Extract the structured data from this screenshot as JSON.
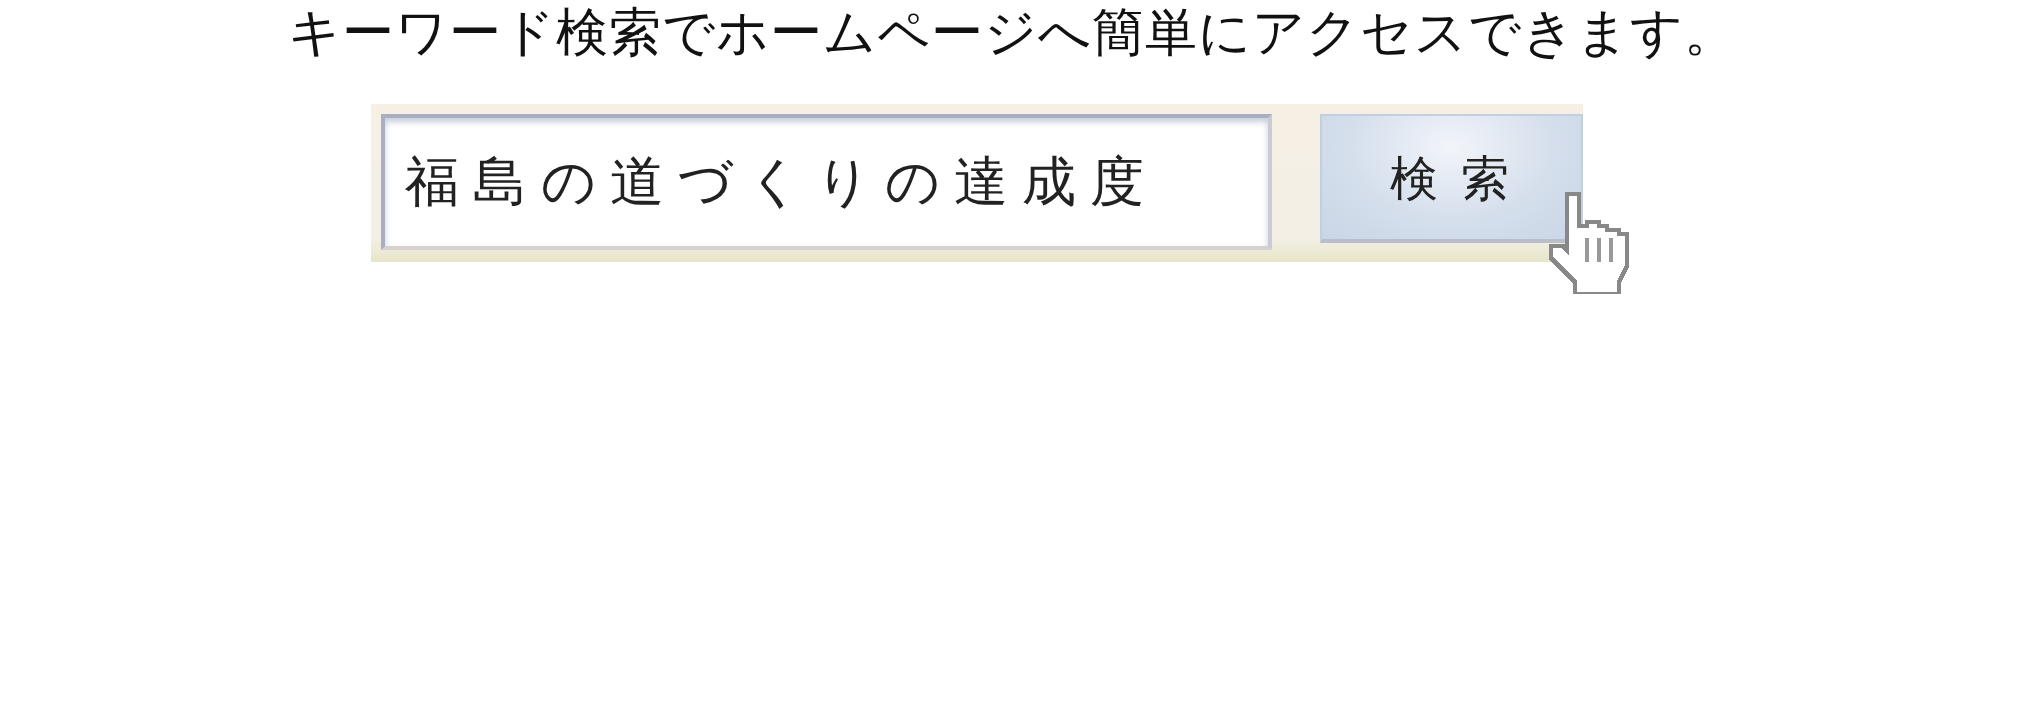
{
  "heading": "キーワード検索でホームページへ簡単にアクセスできます。",
  "search": {
    "value": "福島の道づくりの達成度"
  },
  "button": {
    "label": "検 索"
  }
}
